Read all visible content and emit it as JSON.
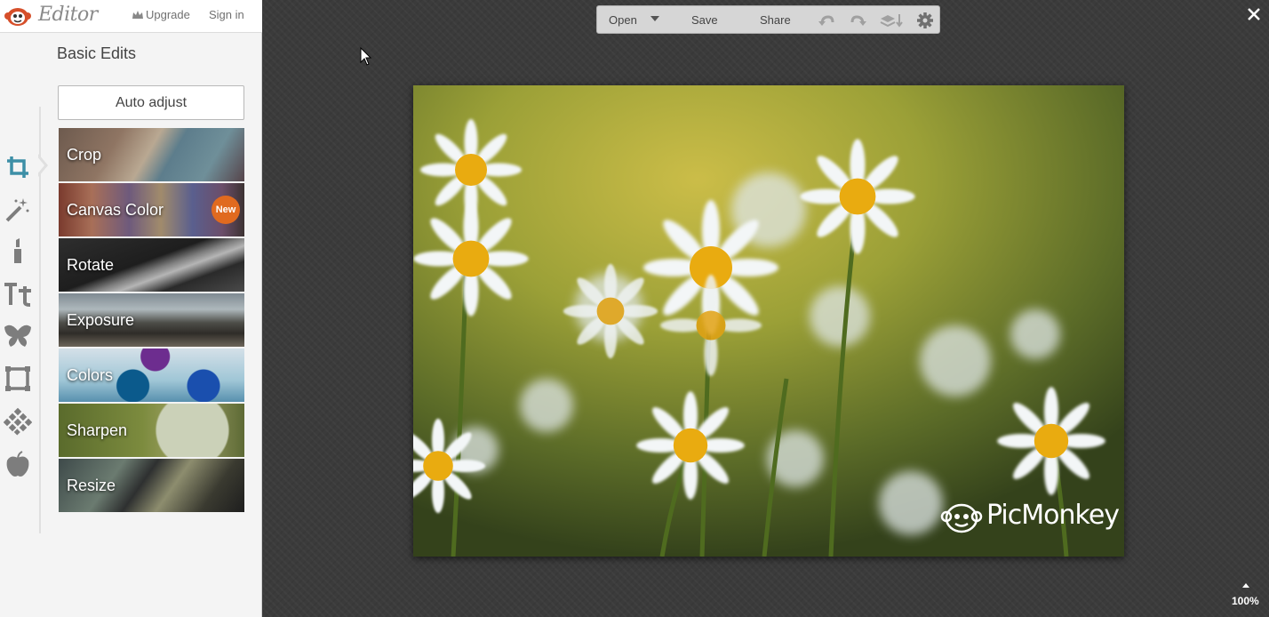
{
  "header": {
    "app_title": "Editor",
    "upgrade_label": "Upgrade",
    "signin_label": "Sign in"
  },
  "panel": {
    "title": "Basic Edits",
    "auto_adjust_label": "Auto adjust",
    "tiles": [
      {
        "label": "Crop"
      },
      {
        "label": "Canvas Color",
        "badge": "New"
      },
      {
        "label": "Rotate"
      },
      {
        "label": "Exposure"
      },
      {
        "label": "Colors"
      },
      {
        "label": "Sharpen"
      },
      {
        "label": "Resize"
      }
    ]
  },
  "rail": {
    "icons": [
      "crop-icon",
      "magic-wand-icon",
      "lipstick-icon",
      "text-icon",
      "butterfly-icon",
      "frame-icon",
      "texture-icon",
      "apple-icon"
    ],
    "active": "crop-icon",
    "active_color": "#3d8fa6",
    "icon_color": "#7d7d7d"
  },
  "toolbar": {
    "open_label": "Open",
    "save_label": "Save",
    "share_label": "Share",
    "icons": [
      "undo-icon",
      "redo-icon",
      "layers-icon",
      "gear-icon"
    ]
  },
  "image": {
    "watermark": "PicMonkey"
  },
  "status": {
    "zoom": "100%"
  },
  "colors": {
    "accent": "#3d8fa6",
    "badge": "#e06a1f"
  }
}
